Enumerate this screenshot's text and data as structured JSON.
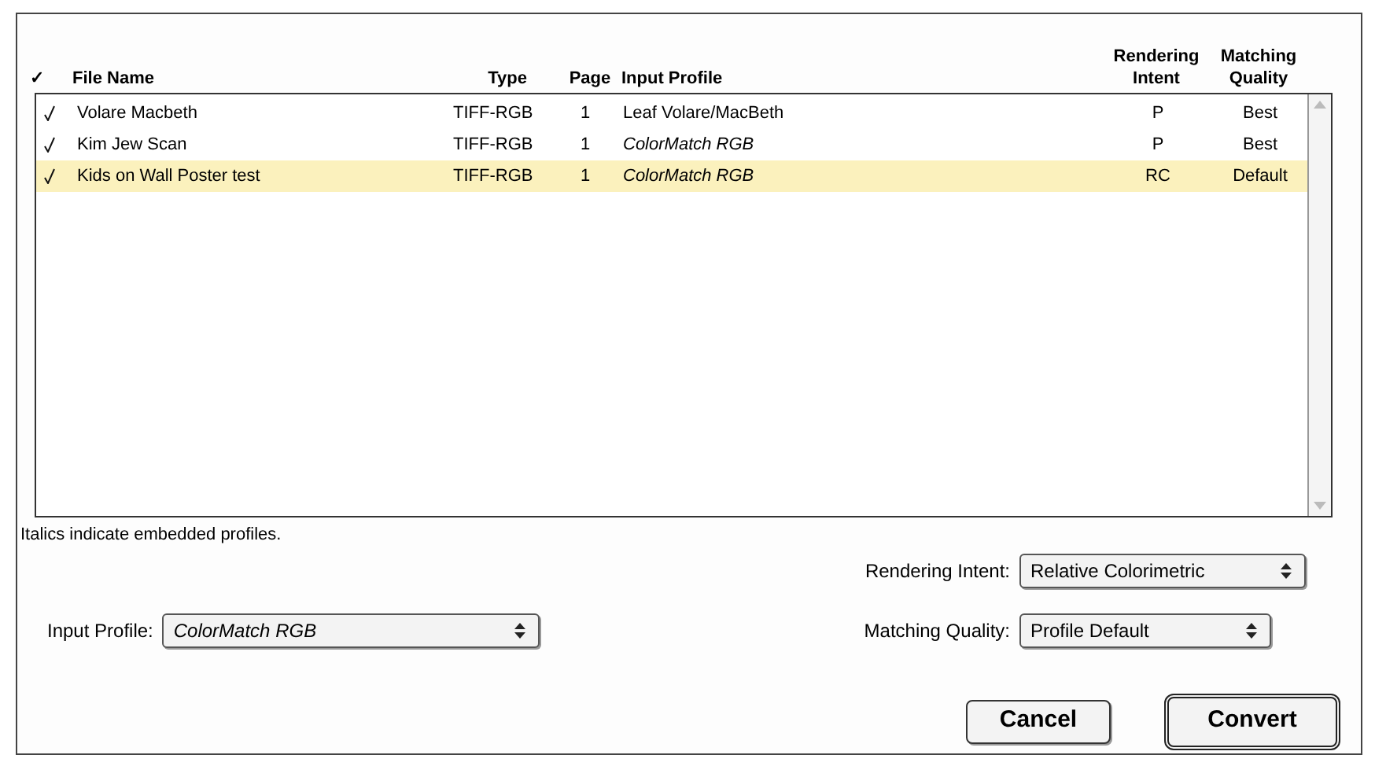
{
  "table": {
    "columns": [
      {
        "label": "✓"
      },
      {
        "label": "File Name"
      },
      {
        "label": "Type"
      },
      {
        "label": "Page"
      },
      {
        "label": "Input Profile"
      },
      {
        "label": "Rendering Intent"
      },
      {
        "label": "Matching Quality"
      }
    ],
    "rows": [
      {
        "checked": true,
        "file_name": "Volare Macbeth",
        "type": "TIFF-RGB",
        "page": "1",
        "input_profile": "Leaf Volare/MacBeth",
        "embedded": false,
        "rendering_intent": "P",
        "matching_quality": "Best",
        "selected": false
      },
      {
        "checked": true,
        "file_name": "Kim Jew Scan",
        "type": "TIFF-RGB",
        "page": "1",
        "input_profile": "ColorMatch RGB",
        "embedded": true,
        "rendering_intent": "P",
        "matching_quality": "Best",
        "selected": false
      },
      {
        "checked": true,
        "file_name": "Kids on Wall Poster test",
        "type": "TIFF-RGB",
        "page": "1",
        "input_profile": "ColorMatch RGB",
        "embedded": true,
        "rendering_intent": "RC",
        "matching_quality": "Default",
        "selected": true
      }
    ]
  },
  "note": "Italics indicate embedded profiles.",
  "rendering_intent": {
    "label": "Rendering Intent:",
    "value": "Relative Colorimetric",
    "embedded": false
  },
  "input_profile": {
    "label": "Input Profile:",
    "value": "ColorMatch RGB",
    "embedded": true
  },
  "matching_quality": {
    "label": "Matching Quality:",
    "value": "Profile Default",
    "embedded": false
  },
  "buttons": [
    {
      "label": "Cancel",
      "default": false
    },
    {
      "label": "Convert",
      "default": true
    }
  ]
}
